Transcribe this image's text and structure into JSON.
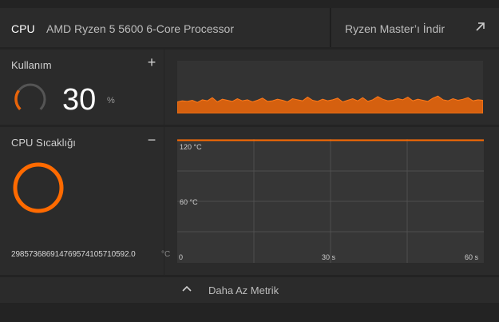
{
  "header": {
    "tab_label": "CPU",
    "processor_name": "AMD Ryzen 5 5600 6-Core Processor",
    "download_label": "Ryzen Master’ı İndir",
    "download_icon": "external-arrow-icon"
  },
  "usage": {
    "title": "Kullanım",
    "toggle": "+",
    "value": "30",
    "unit": "%",
    "percent": 30,
    "history": [
      22,
      24,
      23,
      25,
      21,
      26,
      24,
      30,
      22,
      27,
      25,
      23,
      28,
      24,
      26,
      22,
      25,
      29,
      23,
      24,
      27,
      25,
      22,
      28,
      26,
      24,
      31,
      25,
      23,
      27,
      24,
      26,
      29,
      22,
      25,
      28,
      24,
      30,
      23,
      26,
      32,
      27,
      24,
      25,
      28,
      26,
      31,
      24,
      27,
      25,
      23,
      29,
      33,
      26,
      24,
      28,
      25,
      27,
      30,
      24,
      26,
      25
    ],
    "accent_color": "#e8640a"
  },
  "temperature": {
    "title": "CPU Sıcaklığı",
    "toggle": "−",
    "value": "298573686914769574105710592.0",
    "unit": "°C",
    "axis_labels": {
      "high": "120 °C",
      "mid": "60 °C"
    },
    "time_labels": {
      "start": "0",
      "mid": "30 s",
      "end": "60 s"
    },
    "accent_color": "#ff6a00"
  },
  "footer": {
    "label": "Daha Az Metrik",
    "icon": "chevron-up-icon"
  }
}
